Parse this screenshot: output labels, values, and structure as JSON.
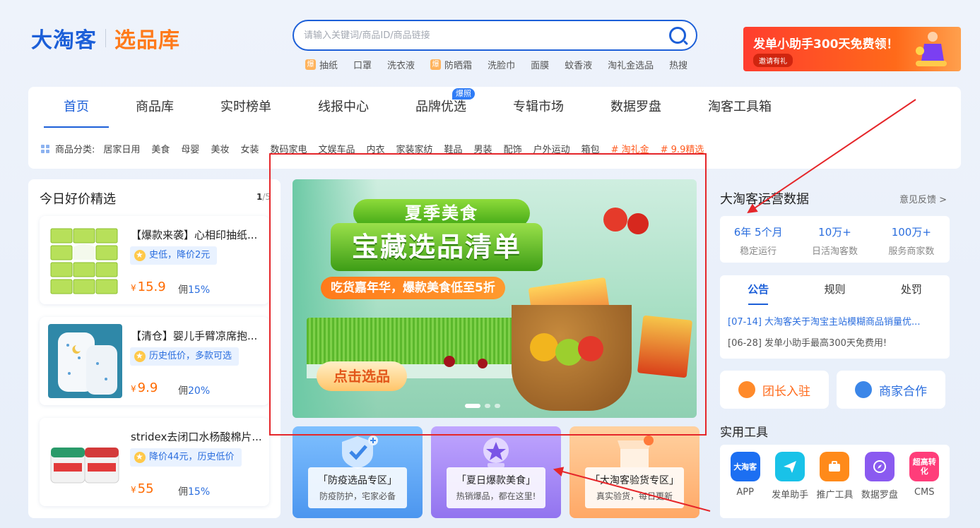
{
  "logo": {
    "main": "大淘客",
    "sub": "选品库"
  },
  "search": {
    "placeholder": "请输入关键词/商品ID/商品链接"
  },
  "hot_badge": "爆",
  "hotwords": [
    {
      "label": "抽纸",
      "hot": true
    },
    {
      "label": "口罩",
      "hot": false
    },
    {
      "label": "洗衣液",
      "hot": false
    },
    {
      "label": "防晒霜",
      "hot": true
    },
    {
      "label": "洗脸巾",
      "hot": false
    },
    {
      "label": "面膜",
      "hot": false
    },
    {
      "label": "蚊香液",
      "hot": false
    },
    {
      "label": "淘礼金选品",
      "hot": false
    },
    {
      "label": "热搜",
      "hot": false
    }
  ],
  "promo": {
    "title": "发单小助手300天免费领！",
    "badge": "邀请有礼"
  },
  "nav": {
    "tabs": [
      "首页",
      "商品库",
      "实时榜单",
      "线报中心",
      "品牌优选",
      "专辑市场",
      "数据罗盘",
      "淘客工具箱"
    ],
    "brand_tag": "爆照"
  },
  "categories": {
    "label": "商品分类:",
    "items": [
      "居家日用",
      "美食",
      "母婴",
      "美妆",
      "女装",
      "数码家电",
      "文娱车品",
      "内衣",
      "家装家纺",
      "鞋品",
      "男装",
      "配饰",
      "户外运动",
      "箱包"
    ],
    "hot_items": [
      "# 淘礼金",
      "# 9.9精选"
    ]
  },
  "left": {
    "title": "今日好价精选",
    "pager_current": "1",
    "pager_total": "/5",
    "currency": "¥",
    "products": [
      {
        "name": "【爆款来袭】心相印抽纸...",
        "tag": "史低，降价2元",
        "price": "15.9",
        "commission_label": "佣",
        "commission": "15%"
      },
      {
        "name": "【清仓】婴儿手臂凉席抱...",
        "tag": "历史低价，多款可选",
        "price": "9.9",
        "commission_label": "佣",
        "commission": "20%"
      },
      {
        "name": "stridex去闭口水杨酸棉片...",
        "tag": "降价44元，历史低价",
        "price": "55",
        "commission_label": "佣",
        "commission": "15%"
      }
    ]
  },
  "banner": {
    "ribbon": "夏季美食",
    "headline": "宝藏选品清单",
    "sub": "吃货嘉年华，爆款美食低至5折",
    "cta": "点击选品"
  },
  "tiles": [
    {
      "title": "「防疫选品专区」",
      "desc": "防疫防护，宅家必备",
      "bg": "#5aa8f5"
    },
    {
      "title": "「夏日爆款美食」",
      "desc": "热销爆品，都在这里!",
      "bg": "#a88bf2"
    },
    {
      "title": "「大淘客验货专区」",
      "desc": "真实验货，每日更新",
      "bg": "#ffb370"
    }
  ],
  "ops": {
    "title": "大淘客运营数据",
    "feedback": "意见反馈 >",
    "stats": [
      {
        "value": "6年 5个月",
        "label": "稳定运行"
      },
      {
        "value": "10万+",
        "label": "日活淘客数"
      },
      {
        "value": "100万+",
        "label": "服务商家数"
      }
    ]
  },
  "notice": {
    "tabs": [
      "公告",
      "规则",
      "处罚"
    ],
    "items": [
      "[07-14] 大淘客关于淘宝主站模糊商品销量优...",
      "[06-28] 发单小助手最高300天免费用!"
    ]
  },
  "actions": {
    "leader": "团长入驻",
    "merchant": "商家合作"
  },
  "tools": {
    "title": "实用工具",
    "items": [
      {
        "icon_text": "大淘客",
        "label": "APP",
        "color": "#1c6ff2"
      },
      {
        "icon_text": "",
        "label": "发单助手",
        "color": "#19c2e8"
      },
      {
        "icon_text": "",
        "label": "推广工具",
        "color": "#ff8a1a"
      },
      {
        "icon_text": "",
        "label": "数据罗盘",
        "color": "#8a5af0"
      },
      {
        "icon_text": "超高转化",
        "label": "CMS",
        "color": "#ff3d7a"
      }
    ]
  },
  "colors": {
    "brand": "#1c5fd8",
    "accent": "#ff7a1a",
    "annotation": "#e5262a"
  }
}
